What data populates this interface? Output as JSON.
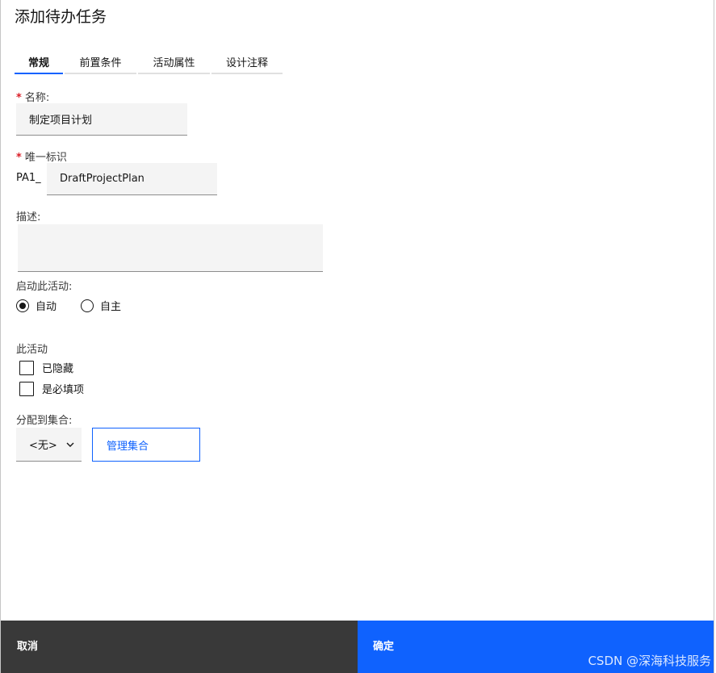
{
  "dialog": {
    "title": "添加待办任务"
  },
  "tabs": [
    {
      "label": "常规",
      "active": true
    },
    {
      "label": "前置条件",
      "active": false
    },
    {
      "label": "活动属性",
      "active": false
    },
    {
      "label": "设计注释",
      "active": false
    }
  ],
  "name_field": {
    "required_mark": "*",
    "label": "名称:",
    "value": "制定项目计划"
  },
  "id_field": {
    "required_mark": "*",
    "label": "唯一标识",
    "prefix": "PA1_",
    "value": "DraftProjectPlan"
  },
  "description_field": {
    "label": "描述:",
    "value": ""
  },
  "start_activity": {
    "label": "启动此活动:",
    "options": [
      {
        "label": "自动",
        "checked": true
      },
      {
        "label": "自主",
        "checked": false
      }
    ]
  },
  "this_activity": {
    "label": "此活动",
    "options": [
      {
        "label": "已隐藏",
        "checked": false
      },
      {
        "label": "是必填项",
        "checked": false
      }
    ]
  },
  "assign_collection": {
    "label": "分配到集合:",
    "selected": "<无>",
    "manage_button": "管理集合"
  },
  "footer": {
    "cancel_label": "取消",
    "ok_label": "确定"
  },
  "watermark": "CSDN @深海科技服务",
  "colors": {
    "primary": "#0f62fe",
    "secondary": "#393939",
    "required": "#da1e28"
  }
}
